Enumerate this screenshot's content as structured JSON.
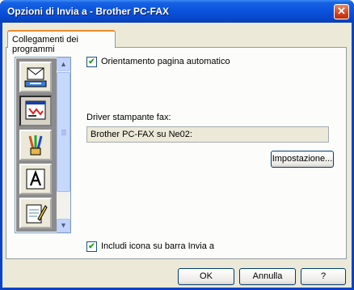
{
  "window": {
    "title": "Opzioni di Invia a - Brother PC-FAX",
    "close_symbol": "✕"
  },
  "tabs": [
    {
      "label": "Collegamenti dei programmi"
    }
  ],
  "options": {
    "auto_orientation": {
      "label": "Orientamento pagina automatico",
      "checked": true
    },
    "include_icon": {
      "label": "Includi icona su barra Invia a",
      "checked": true
    }
  },
  "fax_driver": {
    "label": "Driver stampante fax:",
    "value": "Brother PC-FAX su Ne02:"
  },
  "buttons": {
    "settings": "Impostazione...",
    "ok": "OK",
    "cancel": "Annulla",
    "help": "?"
  },
  "program_icons": [
    {
      "name": "send-mail-icon",
      "selected": false
    },
    {
      "name": "fax-document-icon",
      "selected": true
    },
    {
      "name": "paint-brushes-icon",
      "selected": false
    },
    {
      "name": "font-a-icon",
      "selected": false
    },
    {
      "name": "notepad-icon",
      "selected": false
    }
  ],
  "scrollbar": {
    "up": "▲",
    "down": "▼"
  }
}
